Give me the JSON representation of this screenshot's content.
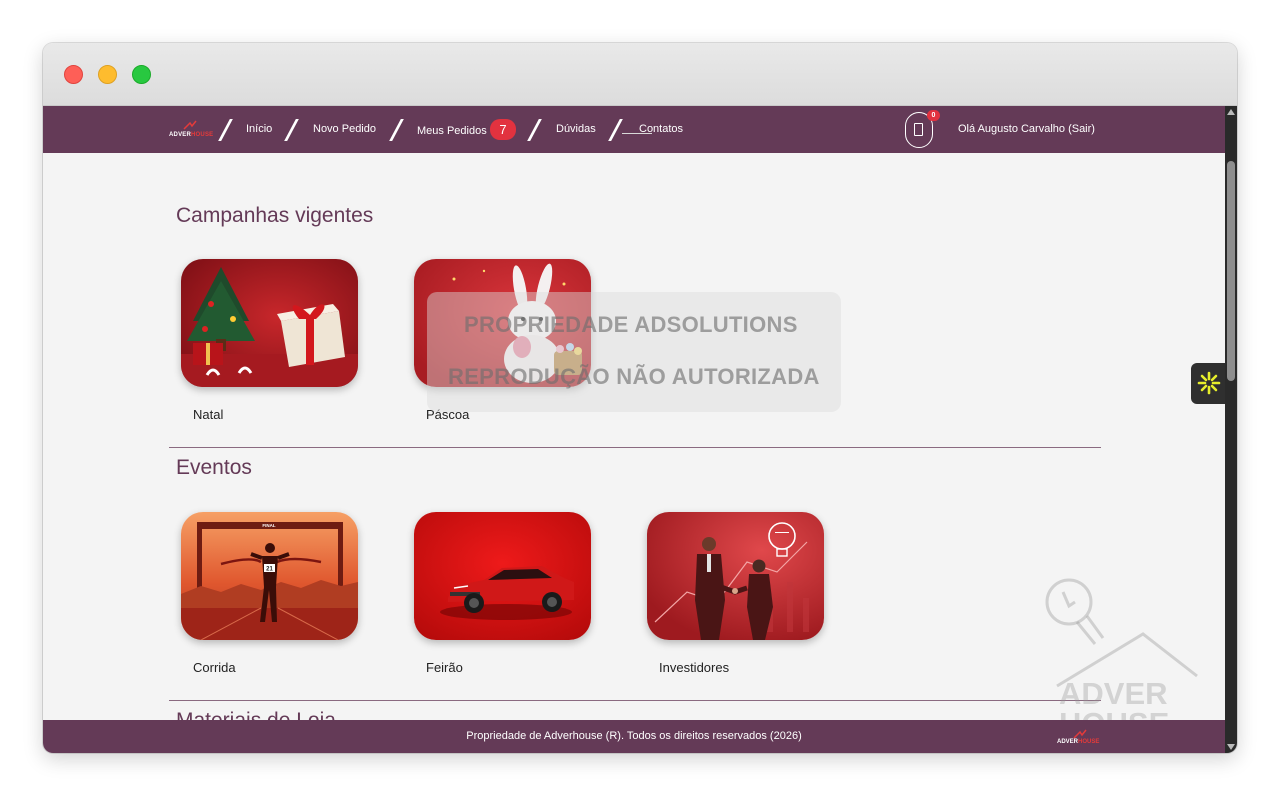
{
  "window": {
    "controls": [
      "close",
      "minimize",
      "maximize"
    ]
  },
  "nav": {
    "logo_text_a": "ADVER",
    "logo_text_b": "HOUSE",
    "links": [
      {
        "label": "Início"
      },
      {
        "label": "Novo Pedido"
      },
      {
        "label": "Meus Pedidos"
      },
      {
        "label": "Dúvidas"
      },
      {
        "label": "Contatos"
      }
    ],
    "orders_count": "7",
    "cart_count": "0",
    "greeting": "Olá Augusto Carvalho (Sair)"
  },
  "sections": [
    {
      "title": "Campanhas vigentes",
      "cards": [
        {
          "label": "Natal",
          "icon": "christmas-gift-image"
        },
        {
          "label": "Páscoa",
          "icon": "easter-bunny-image"
        }
      ]
    },
    {
      "title": "Eventos",
      "cards": [
        {
          "label": "Corrida",
          "icon": "runner-finish-line-image"
        },
        {
          "label": "Feirão",
          "icon": "red-car-image"
        },
        {
          "label": "Investidores",
          "icon": "business-handshake-image"
        }
      ]
    },
    {
      "title": "Materiais de Loja"
    }
  ],
  "watermark": {
    "line1": "PROPRIEDADE ADSOLUTIONS",
    "line2": "REPRODUÇÃO NÃO AUTORIZADA"
  },
  "brand_watermark": {
    "line1": "ADVER",
    "line2": "HOUSE"
  },
  "footer": {
    "text": "Propriedade de Adverhouse (R). Todos os direitos reservados (2026)",
    "logo_text_a": "ADVER",
    "logo_text_b": "HOUSE"
  },
  "colors": {
    "brand": "#643a57",
    "accent_red": "#e2323f",
    "page_bg": "#f4f4f4",
    "widget_star": "#e6ee2b"
  }
}
